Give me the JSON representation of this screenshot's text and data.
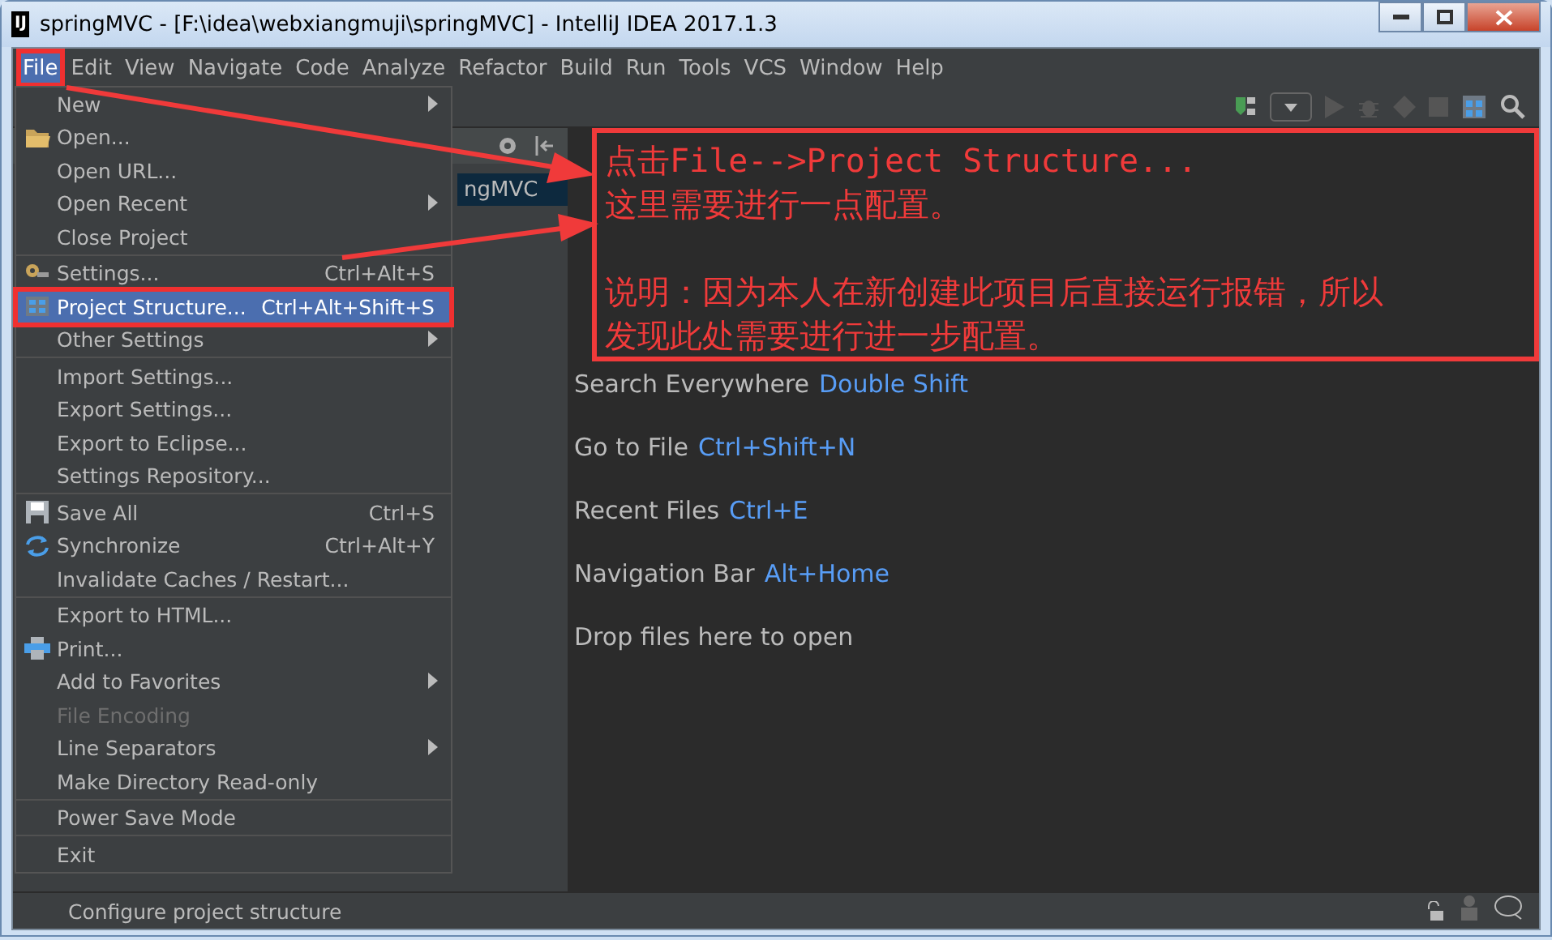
{
  "window": {
    "logo": "IJ",
    "title": "springMVC - [F:\\idea\\webxiangmuji\\springMVC] - IntelliJ IDEA 2017.1.3"
  },
  "menubar": [
    {
      "label": "File",
      "selected": true
    },
    {
      "label": "Edit",
      "selected": false
    },
    {
      "label": "View",
      "selected": false
    },
    {
      "label": "Navigate",
      "selected": false
    },
    {
      "label": "Code",
      "selected": false
    },
    {
      "label": "Analyze",
      "selected": false
    },
    {
      "label": "Refactor",
      "selected": false
    },
    {
      "label": "Build",
      "selected": false
    },
    {
      "label": "Run",
      "selected": false
    },
    {
      "label": "Tools",
      "selected": false
    },
    {
      "label": "VCS",
      "selected": false
    },
    {
      "label": "Window",
      "selected": false
    },
    {
      "label": "Help",
      "selected": false
    }
  ],
  "project_panel": {
    "row": "ngMVC"
  },
  "file_menu": [
    {
      "kind": "item",
      "label": "New",
      "submenu": true,
      "selected": false,
      "disabled": false
    },
    {
      "kind": "item",
      "label": "Open...",
      "submenu": false,
      "selected": false,
      "disabled": false
    },
    {
      "kind": "item",
      "label": "Open URL...",
      "submenu": false,
      "selected": false,
      "disabled": false
    },
    {
      "kind": "item",
      "label": "Open Recent",
      "submenu": true,
      "selected": false,
      "disabled": false
    },
    {
      "kind": "item",
      "label": "Close Project",
      "submenu": false,
      "selected": false,
      "disabled": false
    },
    {
      "kind": "separator"
    },
    {
      "kind": "item",
      "label": "Settings...",
      "shortcut": "Ctrl+Alt+S",
      "submenu": false,
      "selected": false,
      "disabled": false
    },
    {
      "kind": "item",
      "label": "Project Structure...",
      "shortcut": "Ctrl+Alt+Shift+S",
      "submenu": false,
      "selected": true,
      "disabled": false
    },
    {
      "kind": "item",
      "label": "Other Settings",
      "submenu": true,
      "selected": false,
      "disabled": false
    },
    {
      "kind": "separator"
    },
    {
      "kind": "item",
      "label": "Import Settings...",
      "submenu": false,
      "selected": false,
      "disabled": false
    },
    {
      "kind": "item",
      "label": "Export Settings...",
      "submenu": false,
      "selected": false,
      "disabled": false
    },
    {
      "kind": "item",
      "label": "Export to Eclipse...",
      "submenu": false,
      "selected": false,
      "disabled": false
    },
    {
      "kind": "item",
      "label": "Settings Repository...",
      "submenu": false,
      "selected": false,
      "disabled": false
    },
    {
      "kind": "separator"
    },
    {
      "kind": "item",
      "label": "Save All",
      "shortcut": "Ctrl+S",
      "submenu": false,
      "selected": false,
      "disabled": false
    },
    {
      "kind": "item",
      "label": "Synchronize",
      "shortcut": "Ctrl+Alt+Y",
      "submenu": false,
      "selected": false,
      "disabled": false
    },
    {
      "kind": "item",
      "label": "Invalidate Caches / Restart...",
      "submenu": false,
      "selected": false,
      "disabled": false
    },
    {
      "kind": "separator"
    },
    {
      "kind": "item",
      "label": "Export to HTML...",
      "submenu": false,
      "selected": false,
      "disabled": false
    },
    {
      "kind": "item",
      "label": "Print...",
      "submenu": false,
      "selected": false,
      "disabled": false
    },
    {
      "kind": "item",
      "label": "Add to Favorites",
      "submenu": true,
      "selected": false,
      "disabled": false
    },
    {
      "kind": "item",
      "label": "File Encoding",
      "submenu": false,
      "selected": false,
      "disabled": true
    },
    {
      "kind": "item",
      "label": "Line Separators",
      "submenu": true,
      "selected": false,
      "disabled": false
    },
    {
      "kind": "item",
      "label": "Make Directory Read-only",
      "submenu": false,
      "selected": false,
      "disabled": false
    },
    {
      "kind": "separator"
    },
    {
      "kind": "item",
      "label": "Power Save Mode",
      "submenu": false,
      "selected": false,
      "disabled": false
    },
    {
      "kind": "separator"
    },
    {
      "kind": "item",
      "label": "Exit",
      "submenu": false,
      "selected": false,
      "disabled": false
    }
  ],
  "editor_hints": [
    {
      "action": "Search Everywhere",
      "shortcut": "Double Shift"
    },
    {
      "action": "Go to File",
      "shortcut": "Ctrl+Shift+N"
    },
    {
      "action": "Recent Files",
      "shortcut": "Ctrl+E"
    },
    {
      "action": "Navigation Bar",
      "shortcut": "Alt+Home"
    },
    {
      "action": "Drop files here to open"
    }
  ],
  "annotation": {
    "paragraphs": [
      [
        "点击File-->Project Structure...",
        "这里需要进行一点配置。"
      ],
      [
        "说明：因为本人在新创建此项目后直接运行报错，所以",
        "发现此处需要进行进一步配置。"
      ]
    ]
  },
  "status_bar": {
    "text": "Configure project structure"
  }
}
